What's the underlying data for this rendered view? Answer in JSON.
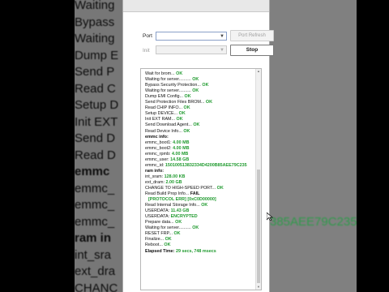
{
  "background": {
    "left_lines": [
      {
        "text": "Waiting",
        "bold": false
      },
      {
        "text": "Bypass",
        "bold": false
      },
      {
        "text": "Waiting",
        "bold": false
      },
      {
        "text": "Dump E",
        "bold": false
      },
      {
        "text": "Send P",
        "bold": false
      },
      {
        "text": "Read C",
        "bold": false
      },
      {
        "text": "Setup D",
        "bold": false
      },
      {
        "text": "Init EXT",
        "bold": false
      },
      {
        "text": "Send D",
        "bold": false
      },
      {
        "text": "Read D",
        "bold": false
      },
      {
        "text": "emmc",
        "bold": true
      },
      {
        "text": "emmc_",
        "bold": false
      },
      {
        "text": "emmc_",
        "bold": false
      },
      {
        "text": "emmc_",
        "bold": false
      },
      {
        "text": "ram in",
        "bold": true
      },
      {
        "text": "int_sra",
        "bold": false
      },
      {
        "text": "ext_dra",
        "bold": false
      },
      {
        "text": "CHANC",
        "bold": false
      }
    ],
    "right_text": "385AEE79C235"
  },
  "form": {
    "port_label": "Port",
    "port_value": "",
    "port_button": "Port Refresh",
    "second_label": "Init",
    "second_value": "",
    "stop_button": "Stop"
  },
  "log": {
    "lines": [
      {
        "text": "Wait for brom...",
        "status": "OK"
      },
      {
        "text": "Waiting for server..........",
        "status": "OK"
      },
      {
        "text": "Bypass Security Protection...",
        "status": "OK"
      },
      {
        "text": "Waiting for server..........",
        "status": "OK"
      },
      {
        "text": "Dump EMI Config...",
        "status": "OK"
      },
      {
        "text": "Send Protection Files BROM...",
        "status": "OK"
      },
      {
        "text": "Read CHIP INFO...",
        "status": "OK"
      },
      {
        "text": "Setup DEVICE...",
        "status": "OK"
      },
      {
        "text": "Init EXT RAM...",
        "status": "OK"
      },
      {
        "text": "Send Download Agent...",
        "status": "OK"
      },
      {
        "text": "Read Device Info...",
        "status": "OK"
      }
    ],
    "emmc_header": "emmc info:",
    "emmc": [
      {
        "key": "emmc_boot1:",
        "value": "4.00 MB"
      },
      {
        "key": "emmc_boot2:",
        "value": "4.00 MB"
      },
      {
        "key": "emmc_rpmb:",
        "value": "4.00 MB"
      },
      {
        "key": "emmc_user:",
        "value": "14.58 GB"
      },
      {
        "key": "emmc_id:",
        "value": "150100513832334D4200B85AEE79C235"
      }
    ],
    "ram_header": "ram info:",
    "ram": [
      {
        "key": "int_sram:",
        "value": "128.00 KB"
      },
      {
        "key": "ext_dram:",
        "value": "2.00 GB"
      }
    ],
    "after_ram": [
      {
        "text": "CHANGE TO HIGH-SPEED PORT...",
        "status": "OK"
      },
      {
        "text": "Read Build Prop Info...",
        "status": "FAIL"
      }
    ],
    "error": "[PROTOCOL ERR] [0xC0D00000]",
    "after_error": [
      {
        "text": "Read Internal Storage Info...",
        "status": "OK"
      }
    ],
    "userdata": [
      {
        "key": "USERDATA:",
        "value": "11.43 GB"
      },
      {
        "key": "USERDATA:",
        "value": "ENCRYPTED"
      }
    ],
    "final": [
      {
        "text": "Prepare data...",
        "status": "OK"
      },
      {
        "text": "Waiting for server..........",
        "status": "OK"
      },
      {
        "text": "RESET FRP...",
        "status": "OK"
      },
      {
        "text": "Finalize...",
        "status": "OK"
      },
      {
        "text": "Reboot...",
        "status": "OK"
      }
    ],
    "elapsed_label": "Elapsed Time:",
    "elapsed_value": "29 secs, 748 msecs"
  },
  "colors": {
    "ok_green": "#1f9a2e"
  }
}
